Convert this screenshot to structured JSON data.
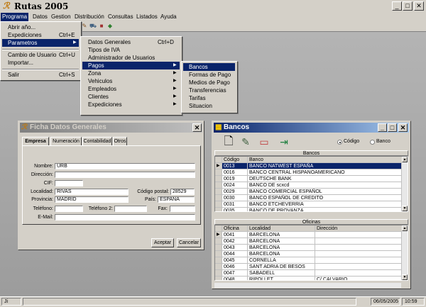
{
  "app": {
    "title": "Rutas 2005"
  },
  "menubar": {
    "items": [
      "Programa",
      "Datos",
      "Gestion",
      "Distribución",
      "Consultas",
      "Listados",
      "Ayuda"
    ]
  },
  "programa_menu": {
    "items": [
      {
        "label": "Abrir año...",
        "shortcut": ""
      },
      {
        "label": "Expediciones",
        "shortcut": "Ctrl+E"
      },
      {
        "label": "Parametros",
        "shortcut": "",
        "submenu": true
      },
      {
        "label": "Cambio de Usuario",
        "shortcut": "Ctrl+U"
      },
      {
        "label": "Importar...",
        "shortcut": ""
      },
      {
        "label": "Salir",
        "shortcut": "Ctrl+S"
      }
    ]
  },
  "parametros_menu": {
    "items": [
      {
        "label": "Datos Generales",
        "shortcut": "Ctrl+D"
      },
      {
        "label": "Tipos de IVA",
        "shortcut": ""
      },
      {
        "label": "Administrador de Usuarios",
        "shortcut": ""
      },
      {
        "label": "Pagos",
        "submenu": true
      },
      {
        "label": "Zona",
        "submenu": true
      },
      {
        "label": "Vehiculos",
        "submenu": true
      },
      {
        "label": "Empleados",
        "submenu": true
      },
      {
        "label": "Clientes",
        "submenu": true
      },
      {
        "label": "Expediciones",
        "submenu": true
      }
    ]
  },
  "pagos_menu": {
    "items": [
      "Bancos",
      "Formas de Pago",
      "Medios de Pago",
      "Transferencias",
      "Tarifas",
      "Situacion"
    ]
  },
  "ficha": {
    "title": "Ficha Datos Generales",
    "tabs": [
      "Empresa",
      "Numeración",
      "Contabilidad",
      "Otros"
    ],
    "fields": {
      "nombre_label": "Nombre:",
      "nombre": "URB",
      "direccion_label": "Dirección:",
      "direccion": "",
      "cif_label": "CIF:",
      "cif": "",
      "localidad_label": "Localidad:",
      "localidad": "RIVAS",
      "codigo_postal_label": "Código postal:",
      "codigo_postal": "28529",
      "provincia_label": "Provincia:",
      "provincia": "MADRID",
      "pais_label": "País:",
      "pais": "ESPAÑA",
      "telefono_label": "Teléfono:",
      "telefono": "",
      "telefono2_label": "Teléfono 2:",
      "telefono2": "",
      "fax_label": "Fax:",
      "fax": "",
      "email_label": "E-Mail:",
      "email": ""
    },
    "accept": "Aceptar",
    "cancel": "Cancelar"
  },
  "bancos": {
    "title": "Bancos",
    "radio_codigo": "Código",
    "radio_banco": "Banco",
    "selected_order": "Código",
    "section_bancos": "Bancos",
    "columns": [
      "Código",
      "Banco"
    ],
    "rows": [
      [
        "0013",
        "BANCO NATWEST ESPAÑA"
      ],
      [
        "0016",
        "BANCO CENTRAL HISPANOAMERICANO"
      ],
      [
        "0019",
        "DEUTSCHE BANK"
      ],
      [
        "0024",
        "BANCO DE scxcd"
      ],
      [
        "0029",
        "BANCO COMERCIAL ESPAÑOL"
      ],
      [
        "0030",
        "BANCO ESPAÑOL DE CREDITO"
      ],
      [
        "0031",
        "BANCO ETCHEVERRIA"
      ],
      [
        "0035",
        "BANCO DE PROVANZA"
      ]
    ],
    "section_oficinas": "Oficinas",
    "of_columns": [
      "Oficina",
      "Localidad",
      "Dirección"
    ],
    "of_rows": [
      [
        "0041",
        "BARCELONA",
        ""
      ],
      [
        "0042",
        "BARCELONA",
        ""
      ],
      [
        "0043",
        "BARCELONA",
        ""
      ],
      [
        "0044",
        "BARCELONA",
        ""
      ],
      [
        "0045",
        "CORNELLA",
        ""
      ],
      [
        "0046",
        "SANT ADRIA DE BESOS",
        ""
      ],
      [
        "0047",
        "SABADELL",
        ""
      ],
      [
        "0048",
        "RIPOLLET",
        "C/ CALVARIO"
      ]
    ]
  },
  "status": {
    "left": "Ji",
    "date": "06/05/2005",
    "time": "10:59"
  }
}
